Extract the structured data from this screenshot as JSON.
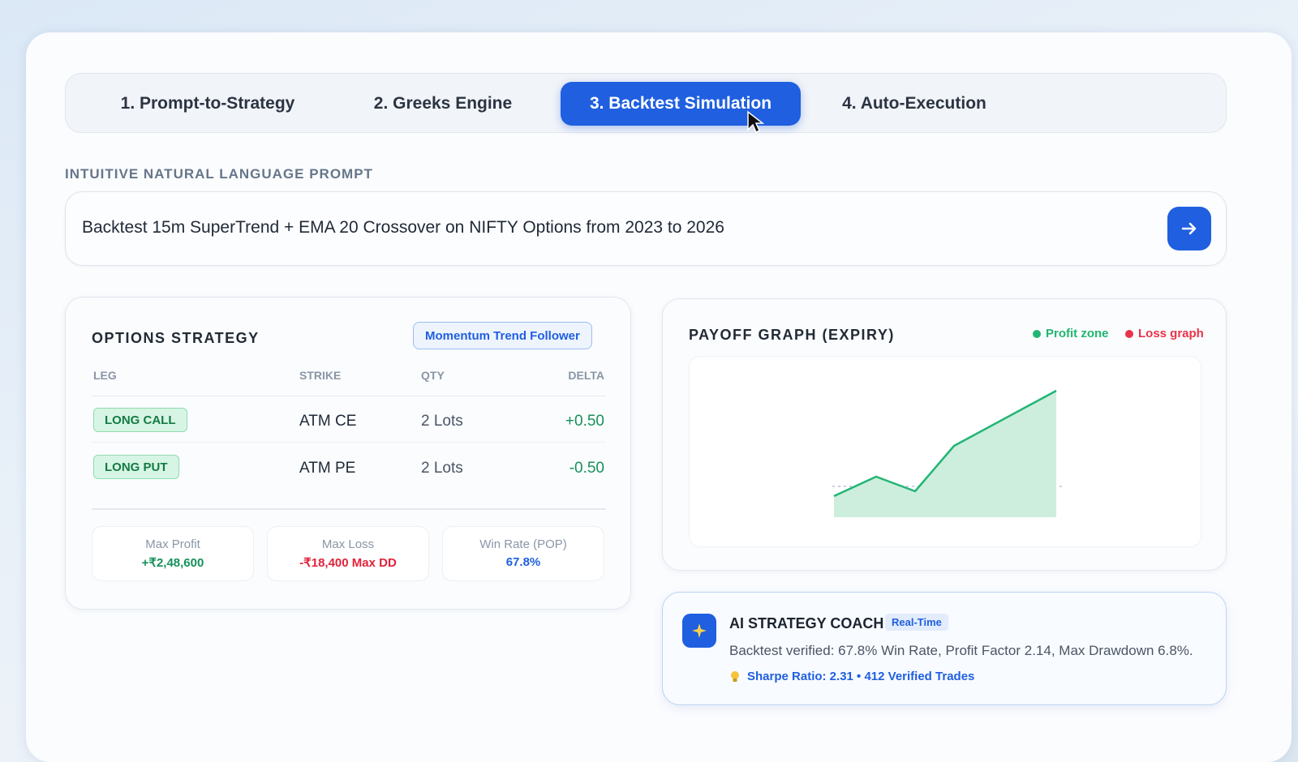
{
  "tabs": [
    {
      "label": "1. Prompt-to-Strategy",
      "active": false
    },
    {
      "label": "2. Greeks Engine",
      "active": false
    },
    {
      "label": "3. Backtest Simulation",
      "active": true
    },
    {
      "label": "4. Auto-Execution",
      "active": false
    }
  ],
  "prompt": {
    "label": "INTUITIVE NATURAL LANGUAGE PROMPT",
    "value": "Backtest 15m SuperTrend + EMA 20 Crossover on NIFTY Options from 2023 to 2026",
    "send_icon": "arrow-right-icon"
  },
  "strategy": {
    "title": "OPTIONS STRATEGY",
    "tag": "Momentum Trend Follower",
    "columns": [
      "LEG",
      "STRIKE",
      "QTY",
      "DELTA"
    ],
    "rows": [
      {
        "leg": "LONG CALL",
        "strike": "ATM CE",
        "qty": "2 Lots",
        "delta": "+0.50"
      },
      {
        "leg": "LONG PUT",
        "strike": "ATM PE",
        "qty": "2 Lots",
        "delta": "-0.50"
      }
    ],
    "stats": [
      {
        "label": "Max Profit",
        "value": "+₹2,48,600",
        "color": "#16915a"
      },
      {
        "label": "Max Loss",
        "value": "-₹18,400 Max DD",
        "color": "#e0223a"
      },
      {
        "label": "Win Rate (POP)",
        "value": "67.8%",
        "color": "#1f5fe0"
      }
    ]
  },
  "payoff": {
    "title": "PAYOFF GRAPH (EXPIRY)",
    "legend": [
      {
        "label": "Profit zone",
        "color": "#22b573"
      },
      {
        "label": "Loss graph",
        "color": "#e8334a"
      }
    ]
  },
  "coach": {
    "title": "AI STRATEGY COACH",
    "badge": "Real-Time",
    "body": "Backtest verified: 67.8% Win Rate, Profit Factor 2.14, Max Drawdown 6.8%.",
    "footer": "Sharpe Ratio: 2.31 • 412 Verified Trades",
    "icon": "sparkle-icon",
    "footer_icon": "lightbulb-icon"
  },
  "colors": {
    "accent": "#1f5fe0",
    "profit": "#16915a",
    "loss": "#e0223a"
  }
}
